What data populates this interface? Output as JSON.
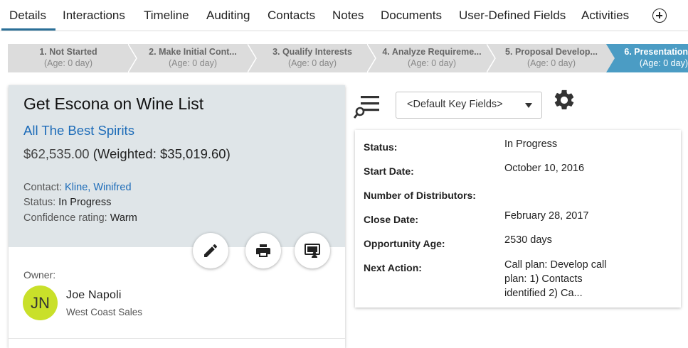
{
  "tabs": [
    {
      "label": "Details",
      "active": true
    },
    {
      "label": "Interactions"
    },
    {
      "label": "Timeline"
    },
    {
      "label": "Auditing"
    },
    {
      "label": "Contacts"
    },
    {
      "label": "Notes"
    },
    {
      "label": "Documents"
    },
    {
      "label": "User-Defined Fields"
    },
    {
      "label": "Activities"
    }
  ],
  "stages": [
    {
      "name": "1. Not Started",
      "age": "(Age: 0 day)"
    },
    {
      "name": "2. Make Initial Cont...",
      "age": "(Age: 0 day)"
    },
    {
      "name": "3. Qualify Interests",
      "age": "(Age: 0 day)"
    },
    {
      "name": "4. Analyze Requireme...",
      "age": "(Age: 0 day)"
    },
    {
      "name": "5. Proposal Develop...",
      "age": "(Age: 0 day)"
    },
    {
      "name": "6. Presentation",
      "age": "(Age: 0 day)",
      "active": true
    }
  ],
  "colors": {
    "stage_inactive": "#dcdcdc",
    "stage_active": "#4b9cc4",
    "accent_link": "#1c6bb8",
    "avatar_bg": "#c9e02a",
    "card_header_bg": "#dfe5e8"
  },
  "opportunity": {
    "title": "Get Escona on Wine List",
    "account": "All The Best Spirits",
    "amount": "$62,535.00",
    "weighted": "(Weighted: $35,019.60)",
    "contact_label": "Contact:",
    "contact_value": "Kline, Winifred",
    "status_label": "Status:",
    "status_value": "In Progress",
    "confidence_label": "Confidence rating:",
    "confidence_value": "Warm"
  },
  "actions": {
    "edit_icon": "pencil-icon",
    "print_icon": "printer-icon",
    "present_icon": "presentation-icon"
  },
  "owner": {
    "label": "Owner:",
    "initials": "JN",
    "name": "Joe Napoli",
    "team": "West Coast Sales"
  },
  "key_fields": {
    "selected": "<Default Key Fields>",
    "rows": [
      {
        "label": "Status:",
        "value": "In Progress"
      },
      {
        "label": "Start Date:",
        "value": "October 10, 2016"
      },
      {
        "label": "Number of Distributors:",
        "value": ""
      },
      {
        "label": "Close Date:",
        "value": "February 28, 2017"
      },
      {
        "label": "Opportunity Age:",
        "value": "2530 days"
      },
      {
        "label": "Next Action:",
        "value": "Call plan: Develop call plan: 1) Contacts identified 2) Ca..."
      }
    ]
  }
}
